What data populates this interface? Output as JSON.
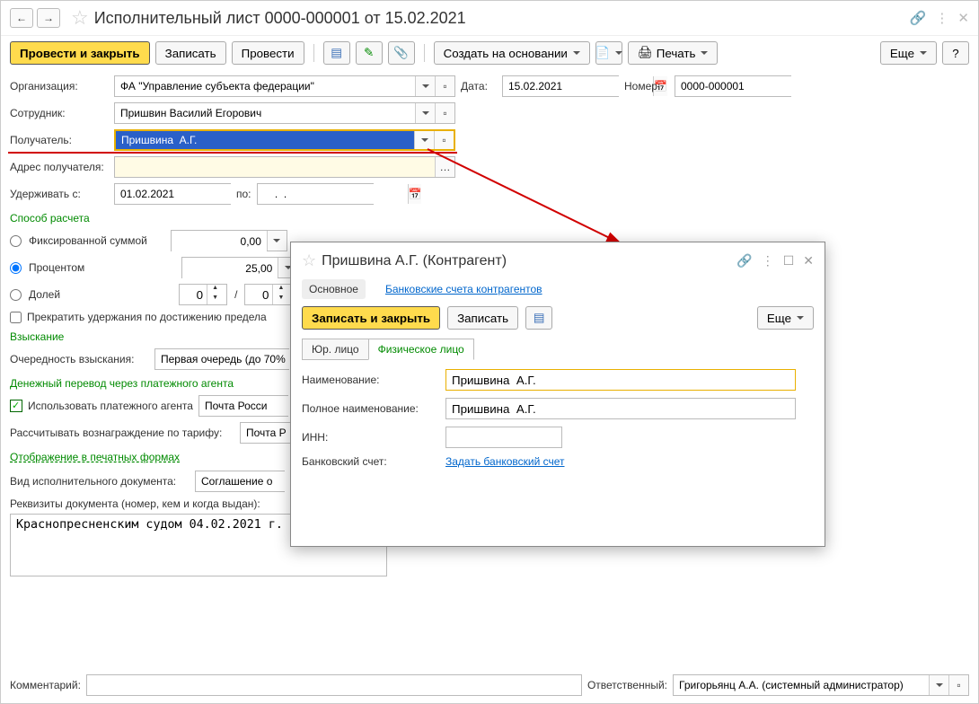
{
  "header": {
    "title": "Исполнительный лист 0000-000001 от 15.02.2021"
  },
  "toolbar": {
    "main": "Провести и закрыть",
    "write": "Записать",
    "post": "Провести",
    "create": "Создать на основании",
    "print": "Печать",
    "more": "Еще"
  },
  "form": {
    "org_label": "Организация:",
    "org_value": "ФА \"Управление субъекта федерации\"",
    "date_label": "Дата:",
    "date_value": "15.02.2021",
    "num_label": "Номер:",
    "num_value": "0000-000001",
    "emp_label": "Сотрудник:",
    "emp_value": "Пришвин Василий Егорович",
    "recv_label": "Получатель:",
    "recv_value": "Пришвина  А.Г.",
    "addr_label": "Адрес получателя:",
    "from_label": "Удерживать с:",
    "from_value": "01.02.2021",
    "to_label": "по:",
    "to_value": "    .  .    ",
    "method_head": "Способ расчета",
    "r_fixed": "Фиксированной суммой",
    "fixed_val": "0,00",
    "r_percent": "Процентом",
    "percent_val": "25,00",
    "r_share": "Долей",
    "share_num": "0",
    "share_den": "0",
    "stop_label": "Прекратить удержания по достижению предела",
    "collect_head": "Взыскание",
    "order_label": "Очередность взыскания:",
    "order_value": "Первая очередь (до 70%",
    "agent_head": "Денежный перевод через платежного агента",
    "use_agent": "Использовать платежного агента",
    "agent_value": "Почта Росси",
    "tariff_label": "Рассчитывать вознаграждение по тарифу:",
    "tariff_value": "Почта Р",
    "print_forms": "Отображение в печатных формах",
    "doc_type_label": "Вид исполнительного документа:",
    "doc_type_value": "Соглашение о",
    "details_label": "Реквизиты документа (номер, кем и когда выдан):",
    "details_value": "Краснопресненским судом 04.02.2021 г."
  },
  "bottom": {
    "comment_label": "Комментарий:",
    "resp_label": "Ответственный:",
    "resp_value": "Григорьянц А.А. (системный администратор)"
  },
  "modal": {
    "title": "Пришвина  А.Г. (Контрагент)",
    "tab_main": "Основное",
    "tab_bank": "Банковские счета контрагентов",
    "btn_main": "Записать и закрыть",
    "btn_write": "Записать",
    "btn_more": "Еще",
    "sub_legal": "Юр. лицо",
    "sub_person": "Физическое лицо",
    "f_name_l": "Наименование:",
    "f_name_v": "Пришвина  А.Г.",
    "f_full_l": "Полное наименование:",
    "f_full_v": "Пришвина  А.Г.",
    "f_inn_l": "ИНН:",
    "f_acct_l": "Банковский счет:",
    "f_acct_link": "Задать банковский счет"
  }
}
